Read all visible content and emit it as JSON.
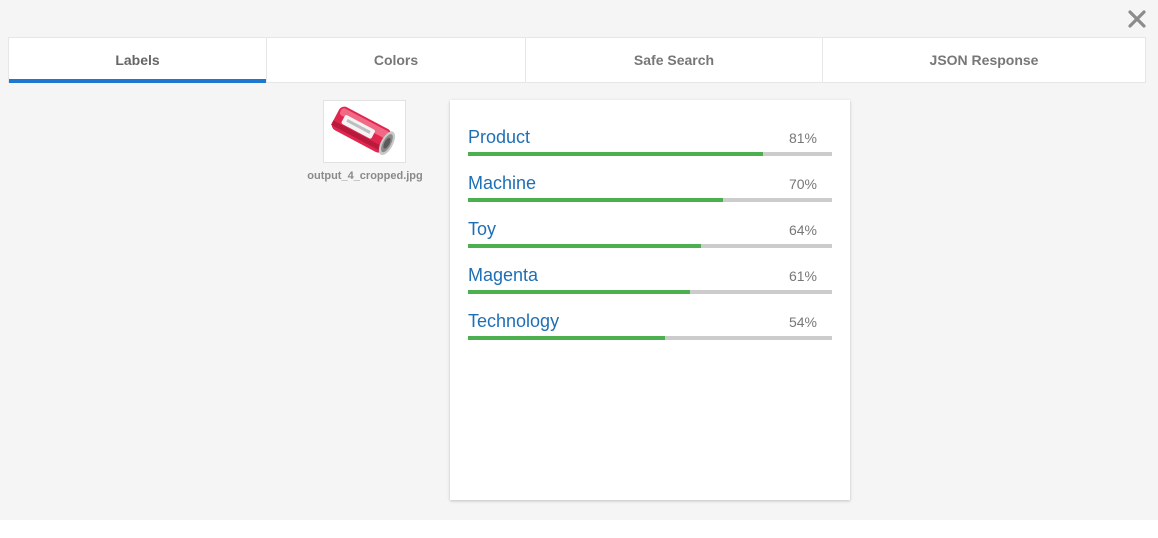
{
  "tabs": [
    {
      "label": "Labels",
      "active": true
    },
    {
      "label": "Colors",
      "active": false
    },
    {
      "label": "Safe Search",
      "active": false
    },
    {
      "label": "JSON Response",
      "active": false
    }
  ],
  "image": {
    "filename": "output_4_cropped.jpg"
  },
  "labels": [
    {
      "name": "Product",
      "score_text": "81%",
      "score": 0.81
    },
    {
      "name": "Machine",
      "score_text": "70%",
      "score": 0.7
    },
    {
      "name": "Toy",
      "score_text": "64%",
      "score": 0.64
    },
    {
      "name": "Magenta",
      "score_text": "61%",
      "score": 0.61
    },
    {
      "name": "Technology",
      "score_text": "54%",
      "score": 0.54
    }
  ],
  "colors": {
    "accent": "#1e78d0",
    "label_text": "#1e6fb5",
    "bar_fill": "#4caf50",
    "bar_track": "#cccccc",
    "background": "#f5f5f5"
  },
  "icons": {
    "close": "close-icon"
  }
}
